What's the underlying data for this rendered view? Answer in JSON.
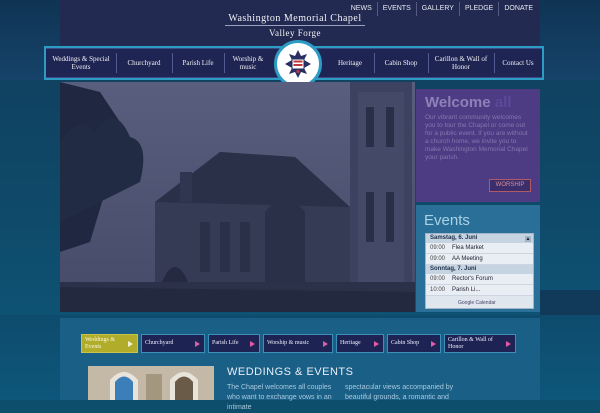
{
  "utility_nav": [
    "NEWS",
    "EVENTS",
    "GALLERY",
    "PLEDGE",
    "DONATE"
  ],
  "site": {
    "title": "Washington Memorial Chapel",
    "subtitle": "Valley Forge"
  },
  "main_nav": {
    "weddings": "Weddings & Special Events",
    "churchyard": "Churchyard",
    "parish": "Parish Life",
    "worship": "Worship & music",
    "heritage": "Heritage",
    "cabin": "Cabin Shop",
    "carillon": "Carillon & Wall of Honor",
    "contact": "Contact Us"
  },
  "welcome": {
    "title_main": "Welcome",
    "title_accent": "all",
    "text": "Our vibrant community welcomes you to tour the Chapel or come out for a public event. If you are without a church home, we invite you to make Washington Memorial Chapel your parish.",
    "button": "WORSHIP"
  },
  "events": {
    "title": "Events",
    "day1": "Samstag, 6. Juni",
    "day1_items": [
      {
        "time": "09:00",
        "name": "Flea Market"
      },
      {
        "time": "09:00",
        "name": "AA Meeting"
      }
    ],
    "day2": "Sonntag, 7. Juni",
    "day2_items": [
      {
        "time": "09:00",
        "name": "Rector's Forum"
      },
      {
        "time": "10:00",
        "name": "Parish Li..."
      }
    ],
    "footer": "Google Calendar"
  },
  "sub_nav": {
    "weddings": "Weddings & Events",
    "churchyard": "Churchyard",
    "parish": "Parish Life",
    "worship": "Worship & music",
    "heritage": "Heritage",
    "cabin": "Cabin Shop",
    "carillon": "Carillon & Wall of Honor"
  },
  "content": {
    "title": "WEDDINGS & EVENTS",
    "col1": "The Chapel welcomes all couples who want to exchange vows in an intimate",
    "col2": "spectacular views accompanied by beautiful grounds, a romantic and"
  },
  "colors": {
    "accent_teal": "#2c9cc4",
    "nav_navy": "#1f2553",
    "welcome_purple": "#4d3b84",
    "active_tab": "#b1ad2a",
    "arrow_pink": "#e25aa8"
  }
}
